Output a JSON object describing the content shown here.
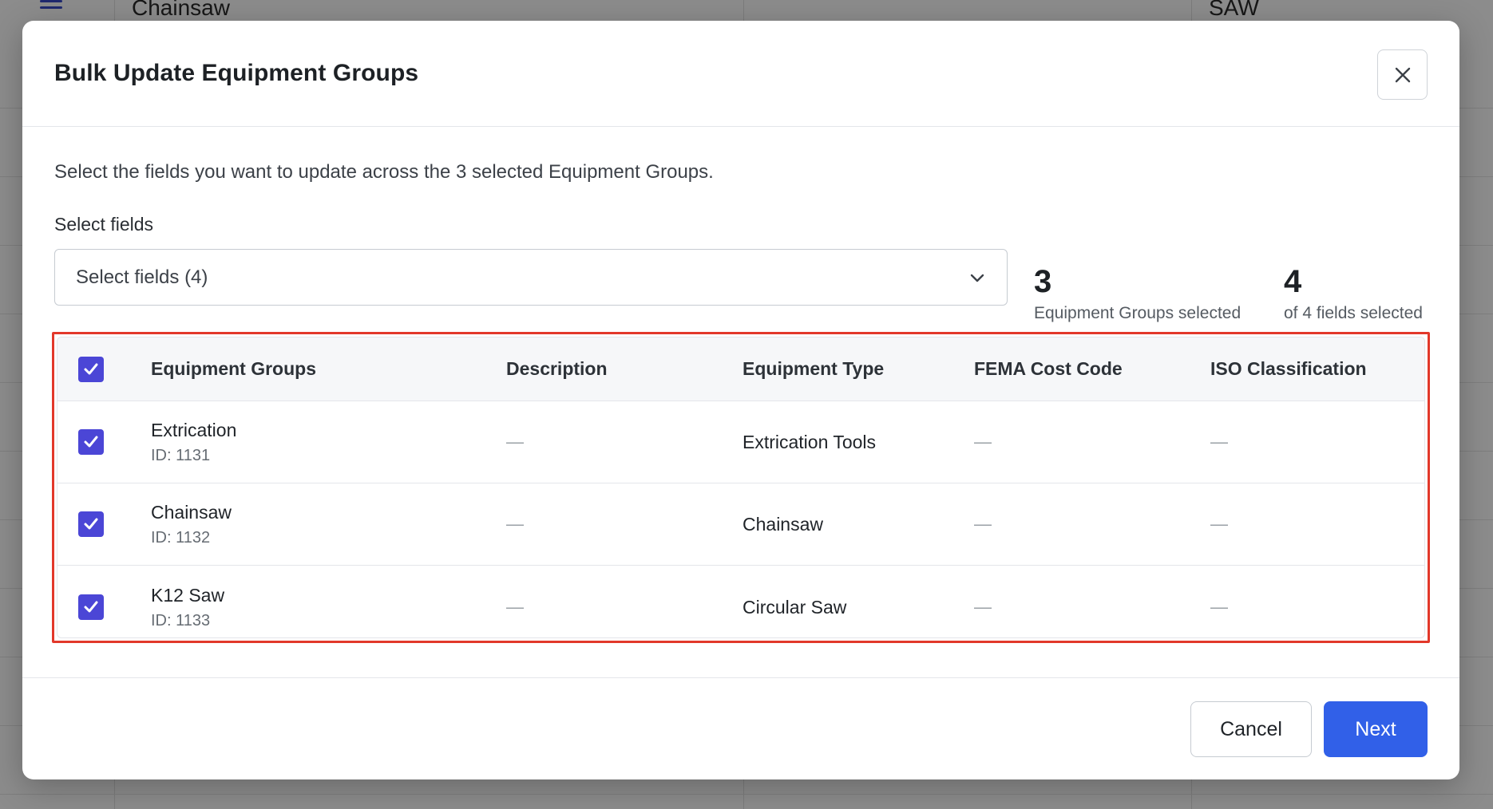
{
  "background": {
    "row_text_1": "Chainsaw",
    "row_text_2": "SAW"
  },
  "modal": {
    "title": "Bulk Update Equipment Groups",
    "close_label": "close",
    "intro": "Select the fields you want to update across the 3 selected Equipment Groups.",
    "select_label": "Select fields",
    "select_value": "Select fields (4)",
    "stats": {
      "groups_count": "3",
      "groups_label": "Equipment Groups selected",
      "fields_count": "4",
      "fields_label": "of 4 fields selected"
    },
    "table": {
      "headers": [
        "Equipment Groups",
        "Description",
        "Equipment Type",
        "FEMA Cost Code",
        "ISO Classification"
      ],
      "rows": [
        {
          "name": "Extrication",
          "id": "ID: 1131",
          "description": "—",
          "type": "Extrication Tools",
          "fema": "—",
          "iso": "—",
          "checked": true
        },
        {
          "name": "Chainsaw",
          "id": "ID: 1132",
          "description": "—",
          "type": "Chainsaw",
          "fema": "—",
          "iso": "—",
          "checked": true
        },
        {
          "name": "K12 Saw",
          "id": "ID: 1133",
          "description": "—",
          "type": "Circular Saw",
          "fema": "—",
          "iso": "—",
          "checked": true
        }
      ]
    },
    "footer": {
      "cancel_label": "Cancel",
      "next_label": "Next"
    }
  },
  "colors": {
    "accent": "#3160e8",
    "checkbox": "#4b46d6",
    "highlight_border": "#e2382a"
  },
  "icons": {
    "close": "close-icon",
    "dropdown": "chevron-down-icon",
    "check": "check-icon",
    "menu": "menu-icon"
  }
}
